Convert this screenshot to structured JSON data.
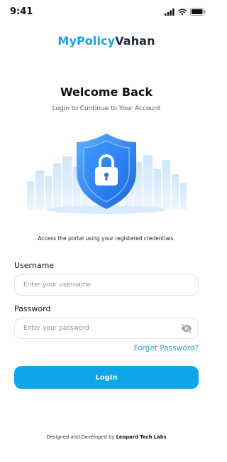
{
  "status_bar": {
    "time": "9:41"
  },
  "brand": {
    "part1": "MyPolicy",
    "part2": "Vahan"
  },
  "header": {
    "title": "Welcome Back",
    "subtitle": "Login to Continue to Your Account"
  },
  "illustration": {
    "icon": "shield-lock-icon"
  },
  "tagline": "Access the portal using your registered credentials.",
  "form": {
    "username_label": "Username",
    "username_placeholder": "Enter your username",
    "username_value": "",
    "password_label": "Password",
    "password_placeholder": "Enter your password",
    "password_value": "",
    "forgot_label": "Forget Password?",
    "login_label": "Login"
  },
  "footer": {
    "prefix": "Designed and Developed by",
    "company": "Leopard Tech Labs"
  },
  "colors": {
    "accent": "#1aa3e8",
    "button": "#0ea5ea",
    "brand_dark": "#1e2a3a"
  }
}
